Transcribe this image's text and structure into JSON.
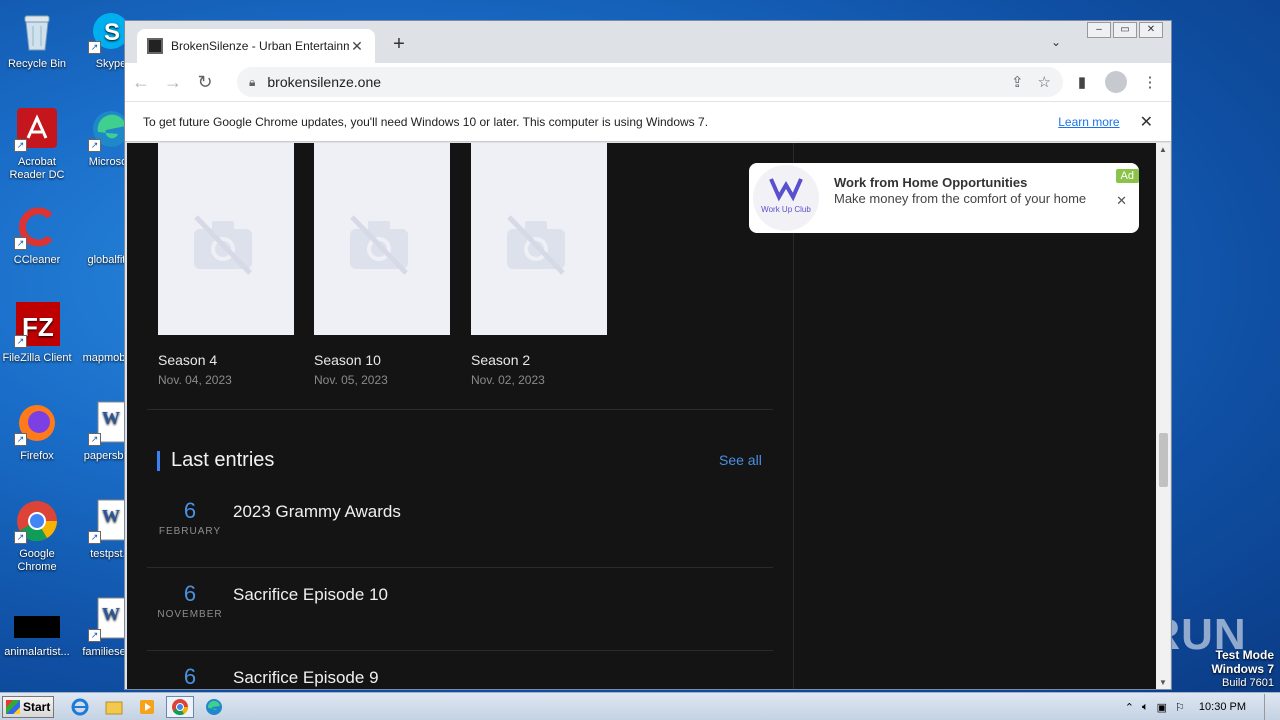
{
  "desktop": {
    "icons": [
      {
        "label": "Recycle Bin"
      },
      {
        "label": "Skype"
      },
      {
        "label": "Acrobat Reader DC"
      },
      {
        "label": "Microsoft"
      },
      {
        "label": "CCleaner"
      },
      {
        "label": "globalfit..."
      },
      {
        "label": "FileZilla Client"
      },
      {
        "label": "mapmobil..."
      },
      {
        "label": "Firefox"
      },
      {
        "label": "papersbir..."
      },
      {
        "label": "Google Chrome"
      },
      {
        "label": "testpst..."
      },
      {
        "label": "animalartist..."
      },
      {
        "label": "familiesev..."
      }
    ],
    "watermark": "ANY RUN",
    "testmode": {
      "line1": "Test Mode",
      "line2": "Windows 7",
      "line3": "Build 7601"
    }
  },
  "browser": {
    "tab_title": "BrokenSilenze - Urban Entertainment",
    "url": "brokensilenze.one",
    "infobar": {
      "message": "To get future Google Chrome updates, you'll need Windows 10 or later. This computer is using Windows 7.",
      "learn_more": "Learn more"
    }
  },
  "page": {
    "cards": [
      {
        "title": "Season 4",
        "date": "Nov. 04, 2023"
      },
      {
        "title": "Season 10",
        "date": "Nov. 05, 2023"
      },
      {
        "title": "Season 2",
        "date": "Nov. 02, 2023"
      }
    ],
    "last_entries": {
      "heading": "Last entries",
      "see_all": "See all",
      "items": [
        {
          "day": "6",
          "month": "FEBRUARY",
          "title": "2023 Grammy Awards"
        },
        {
          "day": "6",
          "month": "NOVEMBER",
          "title": "Sacrifice Episode 10"
        },
        {
          "day": "6",
          "month": "",
          "title": "Sacrifice Episode 9"
        }
      ]
    },
    "ad": {
      "logo_text": "Work Up Club",
      "headline": "Work from Home Opportunities",
      "body": "Make money from the comfort of your home",
      "badge": "Ad"
    }
  },
  "taskbar": {
    "start_label": "Start",
    "clock": "10:30 PM"
  },
  "colors": {
    "accent_blue": "#4a90e2",
    "page_bg": "#141414",
    "ad_badge": "#8bc34a"
  }
}
